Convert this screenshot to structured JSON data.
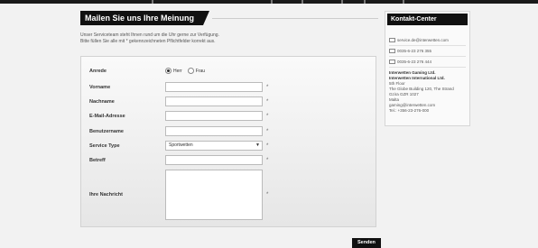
{
  "main": {
    "title": "Mailen Sie uns Ihre Meinung",
    "intro": [
      "Unser Serviceteam steht Ihnen rund um die Uhr gerne zur Verfügung.",
      "Bitte füllen Sie alle mit * gekennzeichneten Pflichtfelder korrekt aus."
    ]
  },
  "form": {
    "salutation": {
      "label": "Anrede",
      "options": [
        "Herr",
        "Frau"
      ],
      "selected": "Herr"
    },
    "first_name": {
      "label": "Vorname",
      "value": ""
    },
    "last_name": {
      "label": "Nachname",
      "value": ""
    },
    "email": {
      "label": "E-Mail-Adresse",
      "value": ""
    },
    "username": {
      "label": "Benutzername",
      "value": ""
    },
    "service_type": {
      "label": "Service Type",
      "value": "Sportwetten"
    },
    "subject": {
      "label": "Betreff",
      "value": ""
    },
    "message": {
      "label": "Ihre Nachricht",
      "value": ""
    },
    "required_mark": "*",
    "submit_label": "Senden"
  },
  "contact": {
    "title": "Kontakt-Center",
    "email": "service.de@interwetten.com",
    "phone1": "0035-6-23 276 355",
    "phone2": "0035-6-23 276 444",
    "company1": "Interwetten Gaming Ltd.",
    "company2": "Interwetten International Ltd.",
    "address": [
      "5th Floor",
      "The Globe Building 120, The Strand",
      "Gzira GZR 1027",
      "Malta"
    ],
    "gaming_email": "gaming@interwetten.com",
    "tel": "Tel.: +356-23-276-000"
  },
  "icons": {
    "email": "envelope-icon",
    "phone": "phone-icon",
    "fax": "fax-icon"
  }
}
